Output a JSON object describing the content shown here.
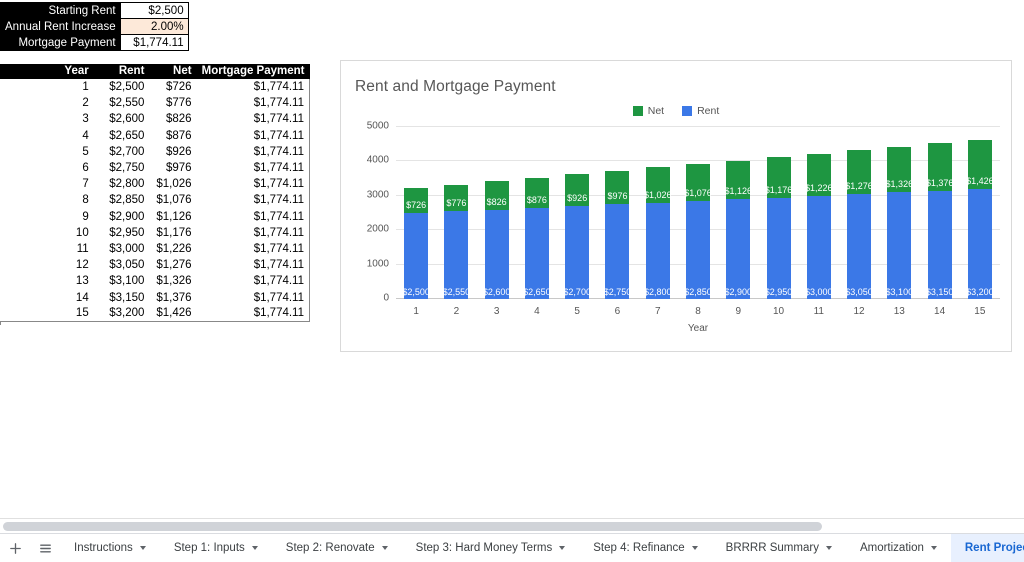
{
  "inputs": {
    "rows": [
      {
        "label": "Starting Rent",
        "value": "$2,500",
        "highlight": false
      },
      {
        "label": "Annual Rent Increase",
        "value": "2.00%",
        "highlight": true
      },
      {
        "label": "Mortgage Payment",
        "value": "$1,774.11",
        "highlight": false
      }
    ]
  },
  "table": {
    "headers": [
      "Year",
      "Rent",
      "Net",
      "Mortgage Payment"
    ],
    "rows": [
      [
        "1",
        "$2,500",
        "$726",
        "$1,774.11"
      ],
      [
        "2",
        "$2,550",
        "$776",
        "$1,774.11"
      ],
      [
        "3",
        "$2,600",
        "$826",
        "$1,774.11"
      ],
      [
        "4",
        "$2,650",
        "$876",
        "$1,774.11"
      ],
      [
        "5",
        "$2,700",
        "$926",
        "$1,774.11"
      ],
      [
        "6",
        "$2,750",
        "$976",
        "$1,774.11"
      ],
      [
        "7",
        "$2,800",
        "$1,026",
        "$1,774.11"
      ],
      [
        "8",
        "$2,850",
        "$1,076",
        "$1,774.11"
      ],
      [
        "9",
        "$2,900",
        "$1,126",
        "$1,774.11"
      ],
      [
        "10",
        "$2,950",
        "$1,176",
        "$1,774.11"
      ],
      [
        "11",
        "$3,000",
        "$1,226",
        "$1,774.11"
      ],
      [
        "12",
        "$3,050",
        "$1,276",
        "$1,774.11"
      ],
      [
        "13",
        "$3,100",
        "$1,326",
        "$1,774.11"
      ],
      [
        "14",
        "$3,150",
        "$1,376",
        "$1,774.11"
      ],
      [
        "15",
        "$3,200",
        "$1,426",
        "$1,774.11"
      ]
    ]
  },
  "chart_data": {
    "type": "bar",
    "stacked": true,
    "title": "Rent and Mortgage Payment",
    "xlabel": "Year",
    "ylabel": "",
    "ylim": [
      0,
      5000
    ],
    "yticks": [
      0,
      1000,
      2000,
      3000,
      4000,
      5000
    ],
    "grid": true,
    "legend_position": "top-center",
    "categories": [
      "1",
      "2",
      "3",
      "4",
      "5",
      "6",
      "7",
      "8",
      "9",
      "10",
      "11",
      "12",
      "13",
      "14",
      "15"
    ],
    "series": [
      {
        "name": "Rent",
        "color": "#3b78e7",
        "values": [
          2500,
          2550,
          2600,
          2650,
          2700,
          2750,
          2800,
          2850,
          2900,
          2950,
          3000,
          3050,
          3100,
          3150,
          3200
        ],
        "labels": [
          "$2,500",
          "$2,550",
          "$2,600",
          "$2,650",
          "$2,700",
          "$2,750",
          "$2,800",
          "$2,850",
          "$2,900",
          "$2,950",
          "$3,000",
          "$3,050",
          "$3,100",
          "$3,150",
          "$3,200"
        ]
      },
      {
        "name": "Net",
        "color": "#1e9641",
        "values": [
          726,
          776,
          826,
          876,
          926,
          976,
          1026,
          1076,
          1126,
          1176,
          1226,
          1276,
          1326,
          1376,
          1426
        ],
        "labels": [
          "$726",
          "$776",
          "$826",
          "$876",
          "$926",
          "$976",
          "$1,026",
          "$1,076",
          "$1,126",
          "$1,176",
          "$1,226",
          "$1,276",
          "$1,326",
          "$1,376",
          "$1,426"
        ]
      }
    ],
    "legend": [
      {
        "label": "Net",
        "color": "#1e9641"
      },
      {
        "label": "Rent",
        "color": "#3b78e7"
      }
    ]
  },
  "sheet_bar": {
    "add_icon": "plus-icon",
    "all_sheets_icon": "hamburger-icon",
    "tabs": [
      {
        "label": "Instructions",
        "active": false,
        "caret": true
      },
      {
        "label": "Step 1: Inputs",
        "active": false,
        "caret": true
      },
      {
        "label": "Step 2: Renovate",
        "active": false,
        "caret": true
      },
      {
        "label": "Step 3: Hard Money Terms",
        "active": false,
        "caret": true
      },
      {
        "label": "Step 4: Refinance",
        "active": false,
        "caret": true
      },
      {
        "label": "BRRRR Summary",
        "active": false,
        "caret": true
      },
      {
        "label": "Amortization",
        "active": false,
        "caret": true
      },
      {
        "label": "Rent Projection",
        "active": true,
        "caret": false
      }
    ]
  }
}
